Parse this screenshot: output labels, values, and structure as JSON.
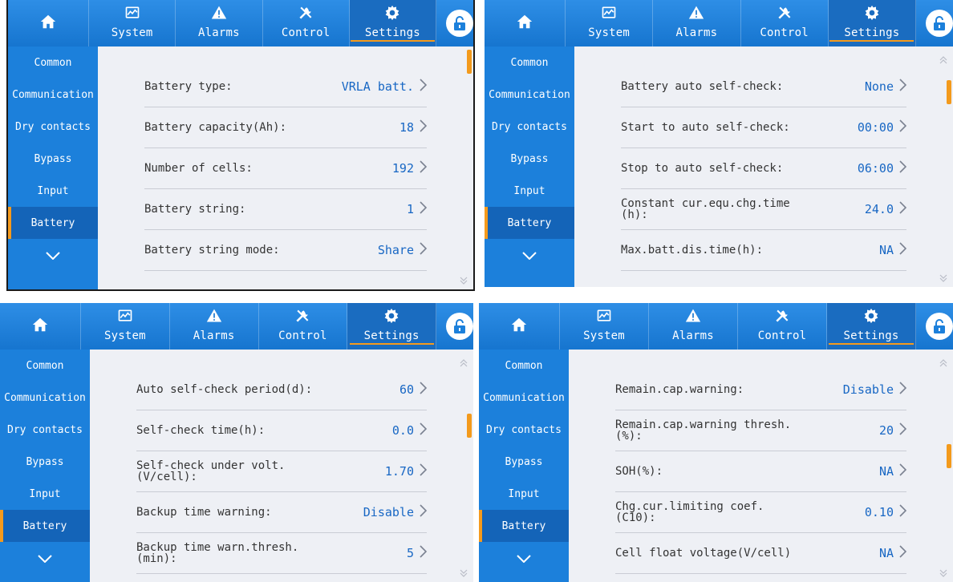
{
  "nav": {
    "tabs": [
      "System",
      "Alarms",
      "Control",
      "Settings"
    ],
    "active_tab": "Settings"
  },
  "sidebar": {
    "items": [
      "Common",
      "Communication",
      "Dry contacts",
      "Bypass",
      "Input",
      "Battery"
    ],
    "active": "Battery"
  },
  "panels": [
    {
      "rows": [
        {
          "name": "Battery type:",
          "value": "VRLA batt."
        },
        {
          "name": "Battery capacity(Ah):",
          "value": "18"
        },
        {
          "name": "Number of cells:",
          "value": "192"
        },
        {
          "name": "Battery string:",
          "value": "1"
        },
        {
          "name": "Battery string mode:",
          "value": "Share"
        }
      ],
      "scroll_position": 0.0
    },
    {
      "rows": [
        {
          "name": "Battery auto self-check:",
          "value": "None"
        },
        {
          "name": "Start to auto self-check:",
          "value": "00:00"
        },
        {
          "name": "Stop to auto self-check:",
          "value": "06:00"
        },
        {
          "name": "Constant cur.equ.chg.time\n(h):",
          "value": "24.0"
        },
        {
          "name": "Max.batt.dis.time(h):",
          "value": "NA"
        }
      ],
      "scroll_position": 0.2
    },
    {
      "rows": [
        {
          "name": "Auto self-check period(d):",
          "value": "60"
        },
        {
          "name": "Self-check time(h):",
          "value": "0.0"
        },
        {
          "name": "Self-check under volt.\n(V/cell):",
          "value": "1.70"
        },
        {
          "name": "Backup time warning:",
          "value": "Disable"
        },
        {
          "name": "Backup time warn.thresh.\n(min):",
          "value": "5"
        }
      ],
      "scroll_position": 0.4
    },
    {
      "rows": [
        {
          "name": "Remain.cap.warning:",
          "value": "Disable"
        },
        {
          "name": "Remain.cap.warning thresh.\n(%):",
          "value": "20"
        },
        {
          "name": "SOH(%):",
          "value": "NA"
        },
        {
          "name": "Chg.cur.limiting coef.\n(C10):",
          "value": "0.10"
        },
        {
          "name": "Cell float voltage(V/cell)",
          "value": "NA"
        }
      ],
      "scroll_position": 0.6
    }
  ],
  "colors": {
    "topbar": "#1c80db",
    "active_indicator": "#f59a1c",
    "value_text": "#1867c4"
  },
  "icons": [
    "home-icon",
    "system-chart-icon",
    "alarm-warning-icon",
    "control-tools-icon",
    "settings-gear-icon",
    "unlock-icon",
    "chevron-down-icon",
    "chevron-right-icon"
  ]
}
